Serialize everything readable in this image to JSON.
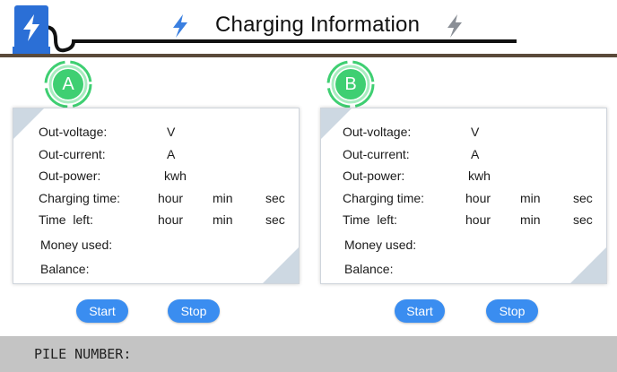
{
  "header": {
    "title": "Charging Information",
    "accent_color": "#2b6fd6",
    "icons": [
      "plug-bolt-icon",
      "lightning-icon",
      "lightning-icon"
    ]
  },
  "chargers": [
    {
      "badge": "A",
      "labels": {
        "voltage": "Out-voltage:",
        "voltage_unit": "V",
        "current": "Out-current:",
        "current_unit": "A",
        "power": "Out-power:",
        "power_unit": "kwh",
        "charging_time": "Charging time:",
        "time_left": "Time  left:",
        "hour": "hour",
        "min": "min",
        "sec": "sec",
        "money": "Money used:",
        "balance": "Balance:"
      },
      "buttons": {
        "start": "Start",
        "stop": "Stop"
      }
    },
    {
      "badge": "B",
      "labels": {
        "voltage": "Out-voltage:",
        "voltage_unit": "V",
        "current": "Out-current:",
        "current_unit": "A",
        "power": "Out-power:",
        "power_unit": "kwh",
        "charging_time": "Charging time:",
        "time_left": "Time  left:",
        "hour": "hour",
        "min": "min",
        "sec": "sec",
        "money": "Money used:",
        "balance": "Balance:"
      },
      "buttons": {
        "start": "Start",
        "stop": "Stop"
      }
    }
  ],
  "footer": {
    "pile_label": "PILE NUMBER:"
  },
  "colors": {
    "badge_green": "#3fcf72",
    "button_blue": "#3a8df0",
    "footer_gray": "#c4c4c4"
  }
}
